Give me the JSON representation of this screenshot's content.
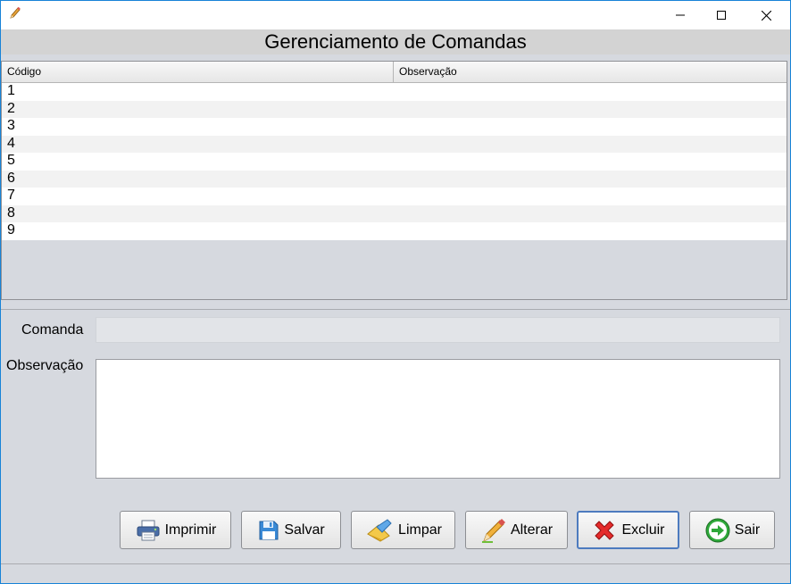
{
  "window": {
    "icon": "pencil-icon",
    "controls": {
      "minimize": "—",
      "maximize": "☐",
      "close": "✕"
    }
  },
  "heading": "Gerenciamento de Comandas",
  "table": {
    "columns": [
      "Código",
      "Observação"
    ],
    "rows": [
      {
        "codigo": "1",
        "observacao": ""
      },
      {
        "codigo": "2",
        "observacao": ""
      },
      {
        "codigo": "3",
        "observacao": ""
      },
      {
        "codigo": "4",
        "observacao": ""
      },
      {
        "codigo": "5",
        "observacao": ""
      },
      {
        "codigo": "6",
        "observacao": ""
      },
      {
        "codigo": "7",
        "observacao": ""
      },
      {
        "codigo": "8",
        "observacao": ""
      },
      {
        "codigo": "9",
        "observacao": ""
      }
    ]
  },
  "form": {
    "comanda_label": "Comanda",
    "comanda_value": "",
    "observacao_label": "Observação",
    "observacao_value": ""
  },
  "buttons": {
    "imprimir": "Imprimir",
    "salvar": "Salvar",
    "limpar": "Limpar",
    "alterar": "Alterar",
    "excluir": "Excluir",
    "sair": "Sair"
  },
  "colors": {
    "window_border": "#1883d7",
    "background": "#d6d9df",
    "delete_red": "#e52b2b",
    "exit_green": "#2fa83a"
  }
}
